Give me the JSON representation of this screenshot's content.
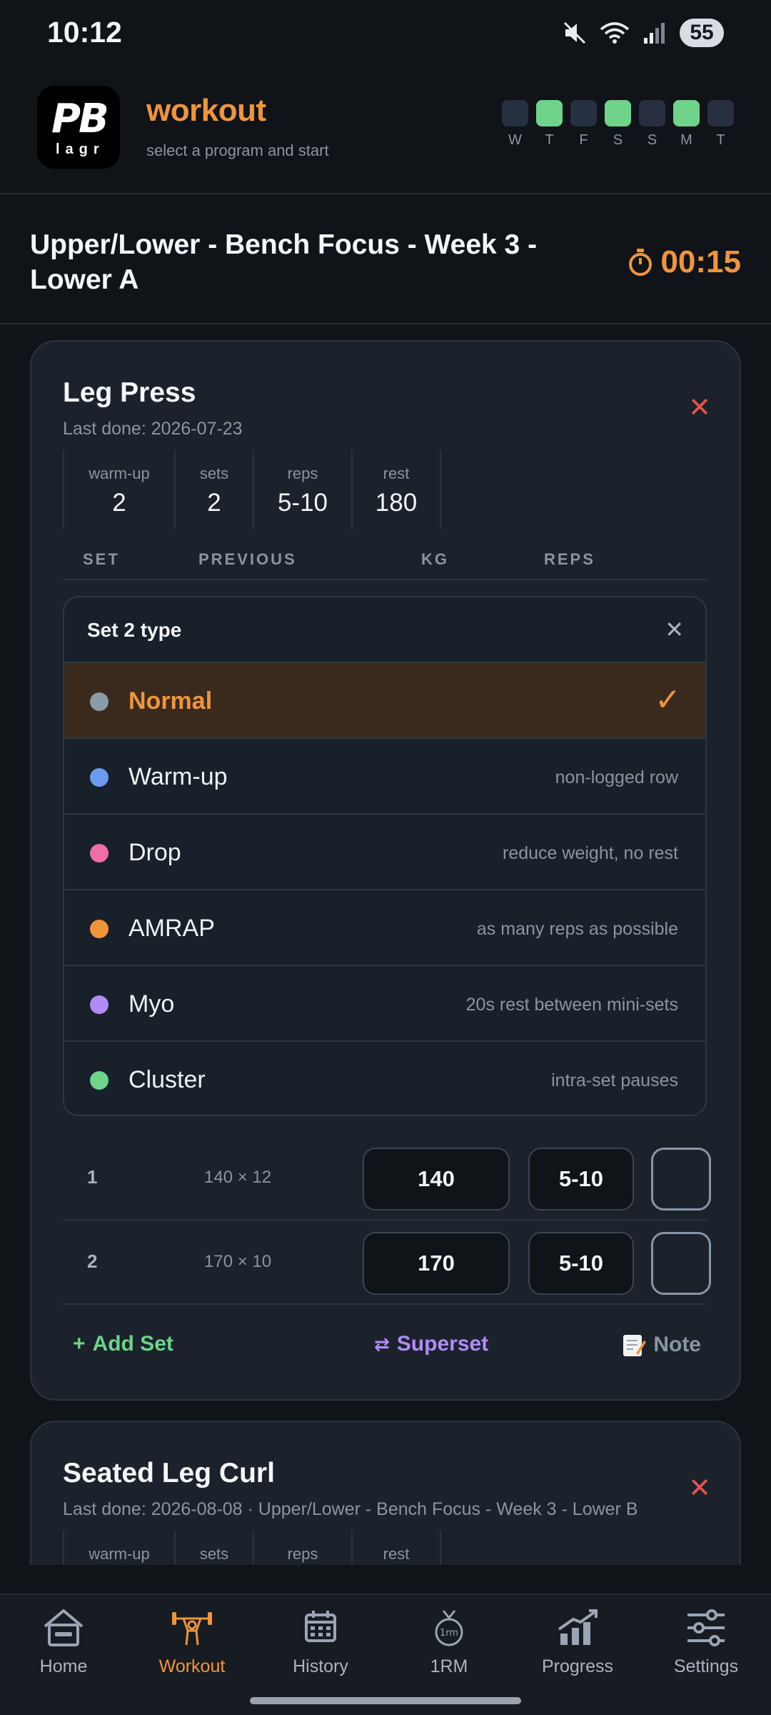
{
  "status": {
    "time": "10:12",
    "battery": "55"
  },
  "header": {
    "logo_text": "PB",
    "logo_sub": "lagr",
    "title": "workout",
    "subtitle": "select a program and start",
    "week": [
      {
        "label": "W",
        "done": false
      },
      {
        "label": "T",
        "done": true
      },
      {
        "label": "F",
        "done": false
      },
      {
        "label": "S",
        "done": true
      },
      {
        "label": "S",
        "done": false
      },
      {
        "label": "M",
        "done": true
      },
      {
        "label": "T",
        "done": false
      }
    ]
  },
  "program": {
    "title": "Upper/Lower - Bench Focus - Week 3 - Lower A",
    "timer": "00:15"
  },
  "exercise1": {
    "name": "Leg Press",
    "last_done": "Last done: 2026-07-23",
    "stats": [
      {
        "label": "warm-up",
        "value": "2"
      },
      {
        "label": "sets",
        "value": "2"
      },
      {
        "label": "reps",
        "value": "5-10"
      },
      {
        "label": "rest",
        "value": "180"
      }
    ],
    "columns": {
      "set": "SET",
      "previous": "PREVIOUS",
      "kg": "KG",
      "reps": "REPS"
    },
    "set_type_menu": {
      "title": "Set 2 type",
      "options": [
        {
          "name": "Normal",
          "desc": "",
          "color": "#8a9baa",
          "selected": true
        },
        {
          "name": "Warm-up",
          "desc": "non-logged row",
          "color": "#6b9cf2",
          "selected": false
        },
        {
          "name": "Drop",
          "desc": "reduce weight, no rest",
          "color": "#ec6fab",
          "selected": false
        },
        {
          "name": "AMRAP",
          "desc": "as many reps as possible",
          "color": "#f0953a",
          "selected": false
        },
        {
          "name": "Myo",
          "desc": "20s rest between mini-sets",
          "color": "#b08cf5",
          "selected": false
        },
        {
          "name": "Cluster",
          "desc": "intra-set pauses",
          "color": "#6fd389",
          "selected": false
        }
      ]
    },
    "sets": [
      {
        "number": "1",
        "previous": "140 × 12",
        "kg": "140",
        "reps": "5-10"
      },
      {
        "number": "2",
        "previous": "170 × 10",
        "kg": "170",
        "reps": "5-10"
      }
    ],
    "actions": {
      "add_set": "Add Set",
      "superset": "Superset",
      "note": "Note"
    }
  },
  "exercise2": {
    "name": "Seated Leg Curl",
    "last_done": "Last done: 2026-08-08 · Upper/Lower - Bench Focus - Week 3 - Lower B",
    "stats": [
      {
        "label": "warm-up"
      },
      {
        "label": "sets"
      },
      {
        "label": "reps"
      },
      {
        "label": "rest"
      }
    ]
  },
  "nav": {
    "items": [
      {
        "label": "Home",
        "icon": "home-icon"
      },
      {
        "label": "Workout",
        "icon": "workout-icon",
        "active": true
      },
      {
        "label": "History",
        "icon": "calendar-icon"
      },
      {
        "label": "1RM",
        "icon": "1rm-icon"
      },
      {
        "label": "Progress",
        "icon": "progress-icon"
      },
      {
        "label": "Settings",
        "icon": "settings-icon"
      }
    ]
  },
  "colors": {
    "accent": "#f0953a",
    "success": "#6fd389",
    "danger": "#e5534b",
    "superset": "#b08cf5"
  }
}
